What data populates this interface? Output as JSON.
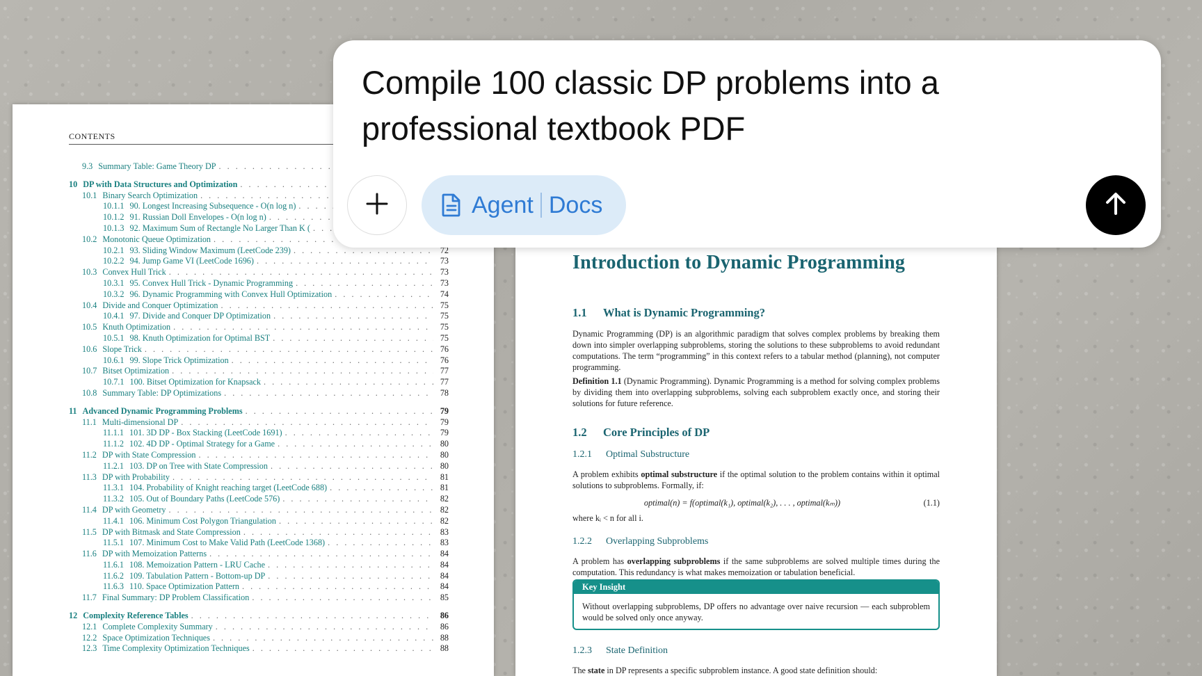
{
  "left_page": {
    "running_head": "CONTENTS",
    "toc": [
      {
        "level": 2,
        "num": "9.3",
        "title": "Summary Table: Game Theory DP",
        "page": ""
      },
      {
        "level": 1,
        "num": "10",
        "title": "DP with Data Structures and Optimization",
        "page": ""
      },
      {
        "level": 2,
        "num": "10.1",
        "title": "Binary Search Optimization",
        "page": ""
      },
      {
        "level": 3,
        "num": "10.1.1",
        "title": "90. Longest Increasing Subsequence - O(n log n)",
        "page": ""
      },
      {
        "level": 3,
        "num": "10.1.2",
        "title": "91. Russian Doll Envelopes - O(n log n)",
        "page": ""
      },
      {
        "level": 3,
        "num": "10.1.3",
        "title": "92. Maximum Sum of Rectangle No Larger Than K (",
        "page": ""
      },
      {
        "level": 2,
        "num": "10.2",
        "title": "Monotonic Queue Optimization",
        "page": ""
      },
      {
        "level": 3,
        "num": "10.2.1",
        "title": "93. Sliding Window Maximum (LeetCode 239)",
        "page": "72"
      },
      {
        "level": 3,
        "num": "10.2.2",
        "title": "94. Jump Game VI (LeetCode 1696)",
        "page": "73"
      },
      {
        "level": 2,
        "num": "10.3",
        "title": "Convex Hull Trick",
        "page": "73"
      },
      {
        "level": 3,
        "num": "10.3.1",
        "title": "95. Convex Hull Trick - Dynamic Programming",
        "page": "73"
      },
      {
        "level": 3,
        "num": "10.3.2",
        "title": "96. Dynamic Programming with Convex Hull Optimization",
        "page": "74"
      },
      {
        "level": 2,
        "num": "10.4",
        "title": "Divide and Conquer Optimization",
        "page": "75"
      },
      {
        "level": 3,
        "num": "10.4.1",
        "title": "97. Divide and Conquer DP Optimization",
        "page": "75"
      },
      {
        "level": 2,
        "num": "10.5",
        "title": "Knuth Optimization",
        "page": "75"
      },
      {
        "level": 3,
        "num": "10.5.1",
        "title": "98. Knuth Optimization for Optimal BST",
        "page": "75"
      },
      {
        "level": 2,
        "num": "10.6",
        "title": "Slope Trick",
        "page": "76"
      },
      {
        "level": 3,
        "num": "10.6.1",
        "title": "99. Slope Trick Optimization",
        "page": "76"
      },
      {
        "level": 2,
        "num": "10.7",
        "title": "Bitset Optimization",
        "page": "77"
      },
      {
        "level": 3,
        "num": "10.7.1",
        "title": "100. Bitset Optimization for Knapsack",
        "page": "77"
      },
      {
        "level": 2,
        "num": "10.8",
        "title": "Summary Table: DP Optimizations",
        "page": "78"
      },
      {
        "level": 1,
        "num": "11",
        "title": "Advanced Dynamic Programming Problems",
        "page": "79"
      },
      {
        "level": 2,
        "num": "11.1",
        "title": "Multi-dimensional DP",
        "page": "79"
      },
      {
        "level": 3,
        "num": "11.1.1",
        "title": "101. 3D DP - Box Stacking (LeetCode 1691)",
        "page": "79"
      },
      {
        "level": 3,
        "num": "11.1.2",
        "title": "102. 4D DP - Optimal Strategy for a Game",
        "page": "80"
      },
      {
        "level": 2,
        "num": "11.2",
        "title": "DP with State Compression",
        "page": "80"
      },
      {
        "level": 3,
        "num": "11.2.1",
        "title": "103. DP on Tree with State Compression",
        "page": "80"
      },
      {
        "level": 2,
        "num": "11.3",
        "title": "DP with Probability",
        "page": "81"
      },
      {
        "level": 3,
        "num": "11.3.1",
        "title": "104. Probability of Knight reaching target (LeetCode 688)",
        "page": "81"
      },
      {
        "level": 3,
        "num": "11.3.2",
        "title": "105. Out of Boundary Paths (LeetCode 576)",
        "page": "82"
      },
      {
        "level": 2,
        "num": "11.4",
        "title": "DP with Geometry",
        "page": "82"
      },
      {
        "level": 3,
        "num": "11.4.1",
        "title": "106. Minimum Cost Polygon Triangulation",
        "page": "82"
      },
      {
        "level": 2,
        "num": "11.5",
        "title": "DP with Bitmask and State Compression",
        "page": "83"
      },
      {
        "level": 3,
        "num": "11.5.1",
        "title": "107. Minimum Cost to Make Valid Path (LeetCode 1368)",
        "page": "83"
      },
      {
        "level": 2,
        "num": "11.6",
        "title": "DP with Memoization Patterns",
        "page": "84"
      },
      {
        "level": 3,
        "num": "11.6.1",
        "title": "108. Memoization Pattern - LRU Cache",
        "page": "84"
      },
      {
        "level": 3,
        "num": "11.6.2",
        "title": "109. Tabulation Pattern - Bottom-up DP",
        "page": "84"
      },
      {
        "level": 3,
        "num": "11.6.3",
        "title": "110. Space Optimization Pattern",
        "page": "84"
      },
      {
        "level": 2,
        "num": "11.7",
        "title": "Final Summary: DP Problem Classification",
        "page": "85"
      },
      {
        "level": 1,
        "num": "12",
        "title": "Complexity Reference Tables",
        "page": "86"
      },
      {
        "level": 2,
        "num": "12.1",
        "title": "Complete Complexity Summary",
        "page": "86"
      },
      {
        "level": 2,
        "num": "12.2",
        "title": "Space Optimization Techniques",
        "page": "88"
      },
      {
        "level": 2,
        "num": "12.3",
        "title": "Time Complexity Optimization Techniques",
        "page": "88"
      }
    ]
  },
  "right_page": {
    "chapter_title": "Introduction to Dynamic Programming",
    "s11_num": "1.1",
    "s11_title": "What is Dynamic Programming?",
    "p1": "Dynamic Programming (DP) is an algorithmic paradigm that solves complex problems by breaking them down into simpler overlapping subproblems, storing the solutions to these subproblems to avoid redundant computations. The term “programming” in this context refers to a tabular method (planning), not computer programming.",
    "def_label": "Definition 1.1",
    "def_name": "(Dynamic Programming).",
    "def_text": "Dynamic Programming is a method for solving complex problems by dividing them into overlapping subproblems, solving each subproblem exactly once, and storing their solutions for future reference.",
    "s12_num": "1.2",
    "s12_title": "Core Principles of DP",
    "s121_num": "1.2.1",
    "s121_title": "Optimal Substructure",
    "p2_a": "A problem exhibits",
    "p2_b": "optimal substructure",
    "p2_c": "if the optimal solution to the problem contains within it optimal solutions to subproblems. Formally, if:",
    "equation": "optimal(n) = f(optimal(k₁), optimal(k₂), . . . , optimal(kₘ))",
    "equation_num": "(1.1)",
    "where": "where kᵢ < n for all i.",
    "s122_num": "1.2.2",
    "s122_title": "Overlapping Subproblems",
    "p3_a": "A problem has",
    "p3_b": "overlapping subproblems",
    "p3_c": "if the same subproblems are solved multiple times during the computation. This redundancy is what makes memoization or tabulation beneficial.",
    "insight_head": "Key Insight",
    "insight_body": "Without overlapping subproblems, DP offers no advantage over naive recursion — each subproblem would be solved only once anyway.",
    "s123_num": "1.2.3",
    "s123_title": "State Definition",
    "p4_a": "The",
    "p4_b": "state",
    "p4_c": "in DP represents a specific subproblem instance. A good state definition should:"
  },
  "prompt": {
    "text": "Compile 100 classic DP problems into a professional textbook PDF",
    "chip_agent": "Agent",
    "chip_docs": "Docs",
    "icons": {
      "add": "plus-icon",
      "chip": "document-icon",
      "send": "arrow-up-icon"
    },
    "colors": {
      "chip_bg": "#dcebf8",
      "chip_text": "#2f7bd4",
      "send_bg": "#000000",
      "toc_text": "#1a8080",
      "heading": "#1a6470",
      "insight": "#16908a"
    }
  }
}
